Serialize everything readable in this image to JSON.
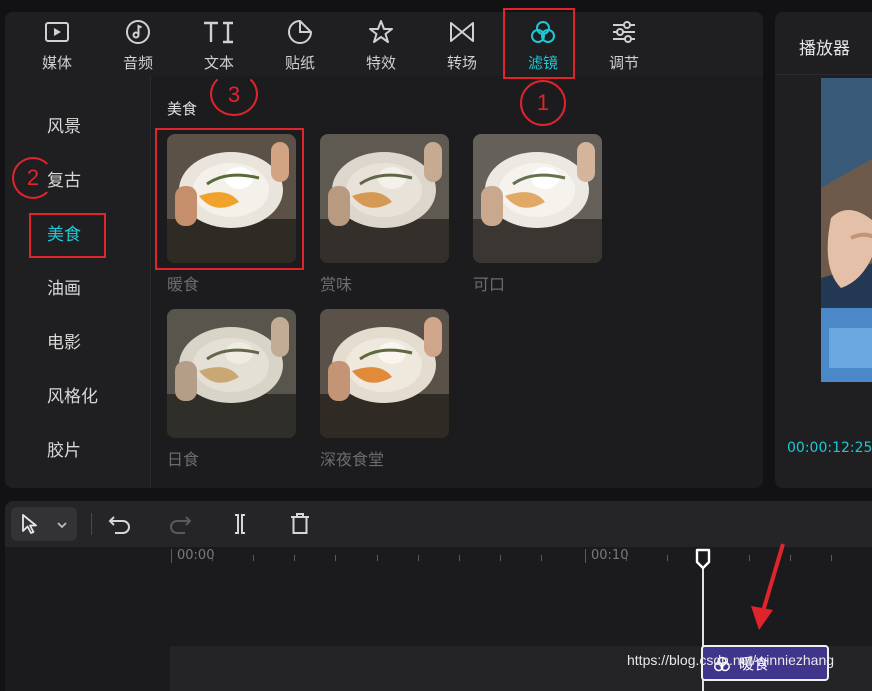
{
  "tabs": [
    {
      "label": "媒体",
      "icon": "media-icon",
      "active": false
    },
    {
      "label": "音频",
      "icon": "audio-icon",
      "active": false
    },
    {
      "label": "文本",
      "icon": "text-icon",
      "active": false
    },
    {
      "label": "贴纸",
      "icon": "sticker-icon",
      "active": false
    },
    {
      "label": "特效",
      "icon": "effects-icon",
      "active": false
    },
    {
      "label": "转场",
      "icon": "transition-icon",
      "active": false
    },
    {
      "label": "滤镜",
      "icon": "filter-icon",
      "active": true
    },
    {
      "label": "调节",
      "icon": "adjust-icon",
      "active": false
    }
  ],
  "categories": [
    {
      "label": "风景",
      "active": false
    },
    {
      "label": "复古",
      "active": false
    },
    {
      "label": "美食",
      "active": true
    },
    {
      "label": "油画",
      "active": false
    },
    {
      "label": "电影",
      "active": false
    },
    {
      "label": "风格化",
      "active": false
    },
    {
      "label": "胶片",
      "active": false
    }
  ],
  "section_title": "美食",
  "filters": [
    {
      "name": "暖食",
      "tone": "warm"
    },
    {
      "name": "赏味",
      "tone": "muted"
    },
    {
      "name": "可口",
      "tone": "bright"
    },
    {
      "name": "日食",
      "tone": "faded"
    },
    {
      "name": "深夜食堂",
      "tone": "orange"
    }
  ],
  "player": {
    "title": "播放器",
    "timecode": "00:00:12:25"
  },
  "timeline": {
    "ruler_labels": [
      "00:00",
      "00:10"
    ],
    "clip_label": "暖食"
  },
  "annotations": {
    "step1": "1",
    "step2": "2",
    "step3": "3"
  },
  "watermark": "https://blog.csdn.net/winniezhang",
  "colors": {
    "accent": "#1ec7d3",
    "annotation_red": "#e0242c",
    "clip_purple": "#3f358a"
  }
}
